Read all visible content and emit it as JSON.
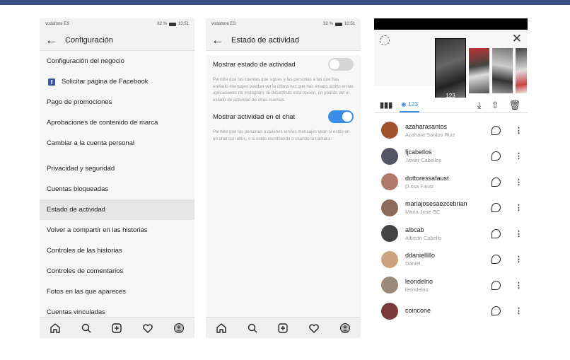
{
  "status_bar": {
    "carrier": "vodafone ES",
    "battery": "82 %",
    "time": "10:51"
  },
  "panel1": {
    "title": "Configuración",
    "items": [
      {
        "label": "Configuración del negocio"
      },
      {
        "label": "Solicitar página de Facebook"
      },
      {
        "label": "Pago de promociones"
      },
      {
        "label": "Aprobaciones de contenido de marca"
      },
      {
        "label": "Cambiar a la cuenta personal"
      },
      {
        "label": "Privacidad y seguridad"
      },
      {
        "label": "Cuentas bloqueadas"
      },
      {
        "label": "Estado de actividad"
      },
      {
        "label": "Volver a compartir en las historias"
      },
      {
        "label": "Controles de las historias"
      },
      {
        "label": "Controles de comentarios"
      },
      {
        "label": "Fotos en las que apareces"
      },
      {
        "label": "Cuentas vinculadas"
      }
    ]
  },
  "panel2": {
    "title": "Estado de actividad",
    "setting1_label": "Mostrar estado de actividad",
    "setting1_desc": "Permite que las cuentas que sigues y las personas a las que has enviado mensajes puedan ver la última vez que has estado activo en las aplicaciones de Instagram. Si desactivas esta opción, no podrás ver el estado de actividad de otras cuentas.",
    "setting2_label": "Mostrar actividad en el chat",
    "setting2_desc": "Permite que las personas a quienes envíes mensajes vean si estás en un chat con ellos, o si estás escribiendo o usando la cámara."
  },
  "panel3": {
    "story_views": "123",
    "tab_views": "123",
    "viewers": [
      {
        "username": "azaharasantos",
        "name": "Azahara Santos Ruiz"
      },
      {
        "username": "fjcabellos",
        "name": "Javier Cabellos"
      },
      {
        "username": "dottoressafaust",
        "name": "D.ssa Faust"
      },
      {
        "username": "mariajosesaezcebrian",
        "name": "Maria Jose SC"
      },
      {
        "username": "albcab",
        "name": "Alberto Cabello"
      },
      {
        "username": "ddaniellillo",
        "name": "Daniel"
      },
      {
        "username": "leondelrio",
        "name": "leondelrio"
      },
      {
        "username": "coincone",
        "name": ""
      }
    ]
  },
  "colors": {
    "accent": "#3a8ee6",
    "top_bar": "#3c4f86",
    "facebook": "#3b5998"
  },
  "icons": [
    "back-arrow-icon",
    "facebook-icon",
    "home-icon",
    "search-icon",
    "add-icon",
    "heart-icon",
    "profile-icon",
    "settings-icon",
    "close-icon",
    "bar-chart-icon",
    "eye-icon",
    "download-icon",
    "share-icon",
    "trash-icon",
    "message-icon",
    "more-icon"
  ]
}
